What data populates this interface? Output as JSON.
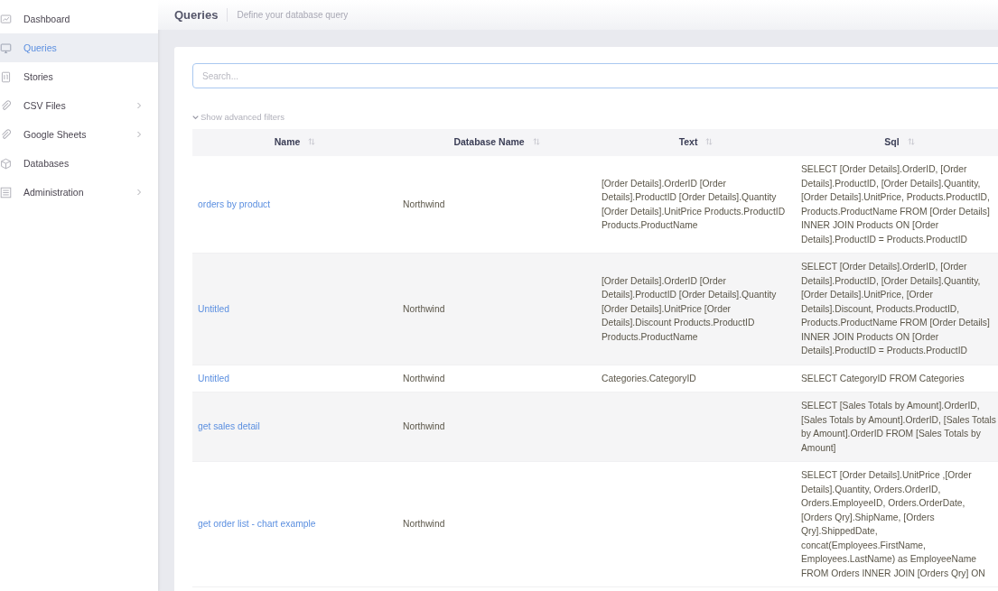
{
  "sidebar": {
    "items": [
      {
        "label": "Dashboard",
        "selected": false,
        "has_submenu": false
      },
      {
        "label": "Queries",
        "selected": true,
        "has_submenu": false
      },
      {
        "label": "Stories",
        "selected": false,
        "has_submenu": false
      },
      {
        "label": "CSV Files",
        "selected": false,
        "has_submenu": true
      },
      {
        "label": "Google Sheets",
        "selected": false,
        "has_submenu": true
      },
      {
        "label": "Databases",
        "selected": false,
        "has_submenu": false
      },
      {
        "label": "Administration",
        "selected": false,
        "has_submenu": true
      }
    ]
  },
  "header": {
    "title": "Queries",
    "subtitle": "Define your database query"
  },
  "search": {
    "placeholder": "Search..."
  },
  "advanced_filters": {
    "label": "Show advanced filters",
    "expanded": false
  },
  "table": {
    "columns": [
      "Name",
      "Database Name",
      "Text",
      "Sql"
    ],
    "rows": [
      {
        "name": "orders by product",
        "database": "Northwind",
        "text": "[Order Details].OrderID [Order Details].ProductID [Order Details].Quantity [Order Details].UnitPrice Products.ProductID Products.ProductName",
        "sql": "SELECT [Order Details].OrderID, [Order Details].ProductID, [Order Details].Quantity, [Order Details].UnitPrice, Products.ProductID, Products.ProductName FROM [Order Details] INNER JOIN Products ON [Order Details].ProductID = Products.ProductID"
      },
      {
        "name": "Untitled",
        "database": "Northwind",
        "text": "[Order Details].OrderID [Order Details].ProductID [Order Details].Quantity [Order Details].UnitPrice [Order Details].Discount Products.ProductID Products.ProductName",
        "sql": "SELECT [Order Details].OrderID, [Order Details].ProductID, [Order Details].Quantity, [Order Details].UnitPrice, [Order Details].Discount, Products.ProductID, Products.ProductName FROM [Order Details] INNER JOIN Products ON [Order Details].ProductID = Products.ProductID"
      },
      {
        "name": "Untitled",
        "database": "Northwind",
        "text": "Categories.CategoryID",
        "sql": "SELECT CategoryID FROM Categories"
      },
      {
        "name": "get sales detail",
        "database": "Northwind",
        "sql": "SELECT [Sales Totals by Amount].OrderID, [Sales Totals by Amount].OrderID, [Sales Totals by Amount].OrderID FROM [Sales Totals by Amount]"
      },
      {
        "name": "get order list - chart example",
        "database": "Northwind",
        "sql": "SELECT [Order Details].UnitPrice ,[Order Details].Quantity, Orders.OrderID, Orders.EmployeeID, Orders.OrderDate, [Orders Qry].ShipName, [Orders Qry].ShippedDate, concat(Employees.FirstName, Employees.LastName) as EmployeeName FROM Orders INNER JOIN [Orders Qry] ON"
      }
    ]
  }
}
